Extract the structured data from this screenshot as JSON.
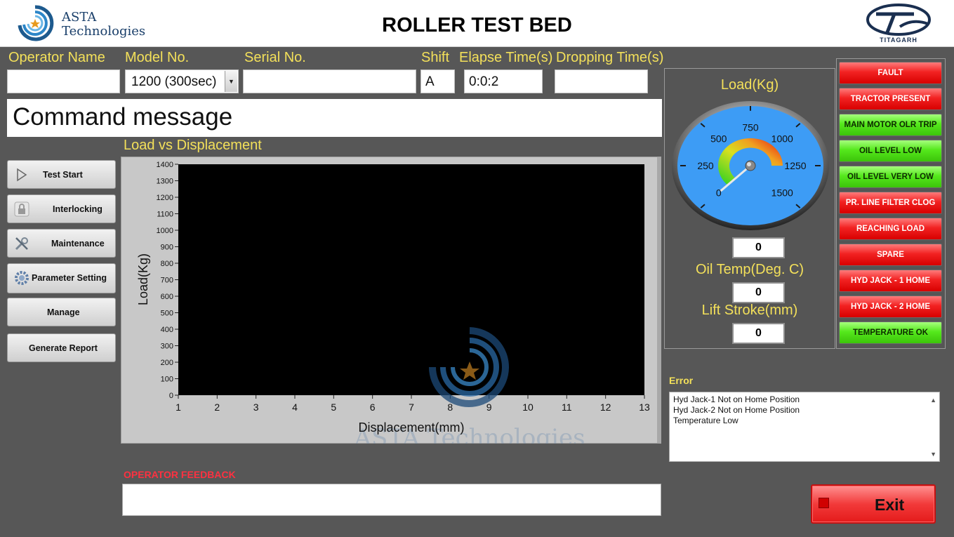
{
  "header": {
    "company_line1": "ASTA",
    "company_line2": "Technologies",
    "title": "ROLLER TEST BED",
    "right_logo_text": "TITAGARH"
  },
  "fields": {
    "operator_name": {
      "label": "Operator Name",
      "value": ""
    },
    "model_no": {
      "label": "Model No.",
      "value": "1200 (300sec)"
    },
    "serial_no": {
      "label": "Serial No.",
      "value": ""
    },
    "shift": {
      "label": "Shift",
      "value": "A"
    },
    "elapse_time": {
      "label": "Elapse Time(s)",
      "value": "0:0:2"
    },
    "dropping_time": {
      "label": "Dropping Time(s)",
      "value": ""
    }
  },
  "command_message": "Command message",
  "nav": {
    "test_start": "Test Start",
    "interlocking": "Interlocking",
    "maintenance": "Maintenance",
    "parameter_setting": "Parameter Setting",
    "manage": "Manage",
    "generate_report": "Generate Report"
  },
  "chart_data": {
    "type": "line",
    "title": "Load vs Displacement",
    "xlabel": "Displacement(mm)",
    "ylabel": "Load(Kg)",
    "xlim": [
      1,
      13
    ],
    "ylim": [
      0,
      1400
    ],
    "xticks": [
      1,
      2,
      3,
      4,
      5,
      6,
      7,
      8,
      9,
      10,
      11,
      12,
      13
    ],
    "yticks": [
      0,
      100,
      200,
      300,
      400,
      500,
      600,
      700,
      800,
      900,
      1000,
      1100,
      1200,
      1300,
      1400
    ],
    "series": [],
    "background": "#000000",
    "watermark": "ASTA Technologies"
  },
  "gauge": {
    "label": "Load(Kg)",
    "min": 0,
    "max": 1500,
    "tick_labels": [
      "0",
      "250",
      "500",
      "750",
      "1000",
      "1250",
      "1500"
    ],
    "value": 0,
    "readout": "0"
  },
  "oil_temp": {
    "label": "Oil Temp(Deg. C)",
    "value": "0"
  },
  "lift_stroke": {
    "label": "Lift Stroke(mm)",
    "value": "0"
  },
  "status_indicators": [
    {
      "label": "FAULT",
      "state": "red"
    },
    {
      "label": "TRACTOR PRESENT",
      "state": "red"
    },
    {
      "label": "MAIN MOTOR OLR TRIP",
      "state": "green"
    },
    {
      "label": "OIL LEVEL LOW",
      "state": "green"
    },
    {
      "label": "OIL LEVEL VERY LOW",
      "state": "green"
    },
    {
      "label": "PR. LINE FILTER CLOG",
      "state": "red"
    },
    {
      "label": "REACHING LOAD",
      "state": "red"
    },
    {
      "label": "SPARE",
      "state": "red"
    },
    {
      "label": "HYD JACK - 1 HOME",
      "state": "red"
    },
    {
      "label": "HYD JACK - 2 HOME",
      "state": "red"
    },
    {
      "label": "TEMPERATURE OK",
      "state": "green"
    }
  ],
  "error": {
    "label": "Error",
    "messages": [
      "Hyd Jack-1 Not on Home Position",
      "Hyd Jack-2 Not on Home Position",
      "Temperature Low"
    ]
  },
  "feedback": {
    "label": "OPERATOR FEEDBACK",
    "value": ""
  },
  "exit_label": "Exit",
  "colors": {
    "label_yellow": "#f3e05a",
    "feedback_red": "#ff3040",
    "indicator_red": "#f22222",
    "indicator_green": "#55e81c",
    "gauge_blue": "#3d9cf5"
  }
}
